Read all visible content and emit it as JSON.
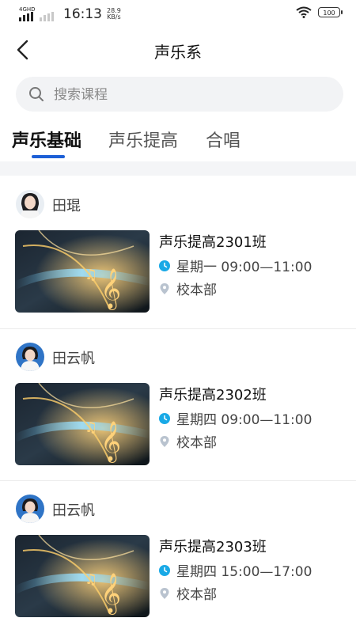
{
  "status_bar": {
    "network": "4GHD",
    "time": "16:13",
    "speed_value": "28.9",
    "speed_unit": "KB/s",
    "battery": "100",
    "icons": [
      "signal-icon",
      "wifi-icon",
      "battery-icon"
    ]
  },
  "header": {
    "title": "声乐系",
    "back_icon": "back-arrow-icon"
  },
  "search": {
    "placeholder": "搜索课程",
    "value": "",
    "icon": "search-icon"
  },
  "tabs": [
    {
      "label": "声乐基础",
      "active": true
    },
    {
      "label": "声乐提高",
      "active": false
    },
    {
      "label": "合唱",
      "active": false
    }
  ],
  "colors": {
    "accent": "#1c5fd6",
    "clock_icon": "#19a9e6",
    "location_icon": "#b9c3cf"
  },
  "courses": [
    {
      "teacher": "田琨",
      "name": "声乐提高2301班",
      "schedule": "星期一 09:00—11:00",
      "location": "校本部"
    },
    {
      "teacher": "田云帆",
      "name": "声乐提高2302班",
      "schedule": "星期四 09:00—11:00",
      "location": "校本部"
    },
    {
      "teacher": "田云帆",
      "name": "声乐提高2303班",
      "schedule": "星期四 15:00—17:00",
      "location": "校本部"
    }
  ]
}
